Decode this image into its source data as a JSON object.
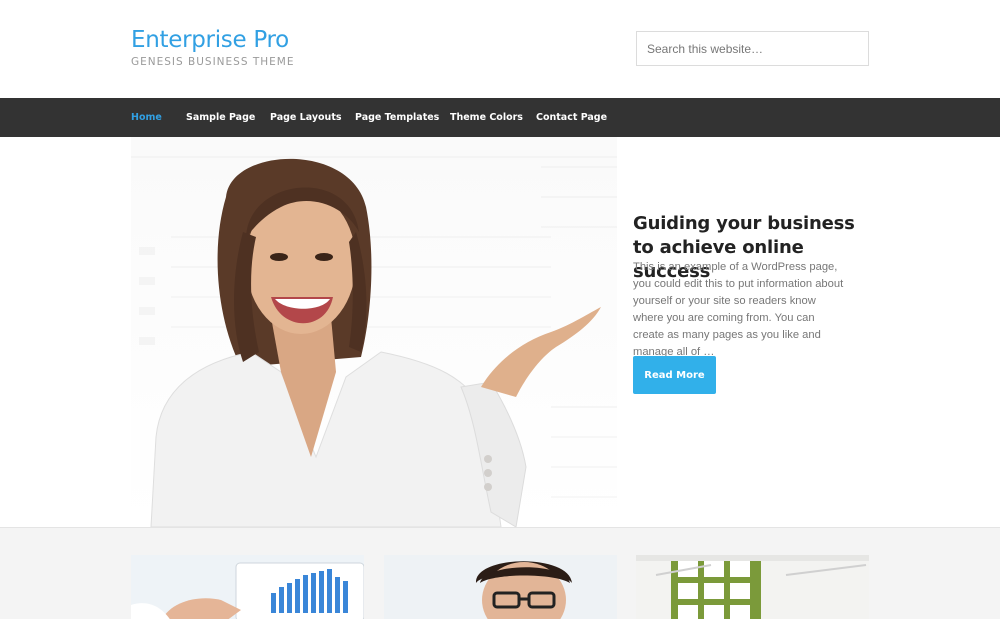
{
  "site": {
    "title": "Enterprise Pro",
    "description": "GENESIS BUSINESS THEME",
    "search_placeholder": "Search this website…"
  },
  "nav": {
    "items": [
      {
        "label": "Home",
        "active": true
      },
      {
        "label": "Sample Page",
        "active": false
      },
      {
        "label": "Page Layouts",
        "active": false
      },
      {
        "label": "Page Templates",
        "active": false
      },
      {
        "label": "Theme Colors",
        "active": false
      },
      {
        "label": "Contact Page",
        "active": false
      }
    ]
  },
  "hero": {
    "title": "Guiding your business to achieve online success",
    "text": "This is an example of a WordPress page, you could edit this to put information about yourself or your site so readers know where you are coming from. You can create as many pages as you like and manage all of …",
    "button_label": "Read More"
  },
  "colors": {
    "accent": "#31a0e3",
    "button": "#31b0ea",
    "nav_bg": "#333333",
    "lower_bg": "#f4f4f4"
  }
}
